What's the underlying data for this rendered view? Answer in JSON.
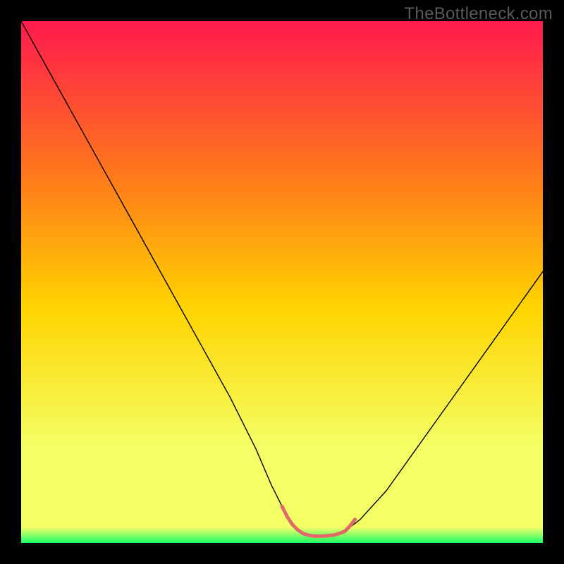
{
  "watermark": "TheBottleneck.com",
  "chart_data": {
    "type": "line",
    "title": "",
    "xlabel": "",
    "ylabel": "",
    "xlim": [
      0,
      100
    ],
    "ylim": [
      0,
      100
    ],
    "background_gradient": {
      "top": "#ff1a4d",
      "upper_mid": "#ff7a1a",
      "mid": "#ffd400",
      "lower_mid": "#f4ff66",
      "bottom": "#1aff66"
    },
    "series": [
      {
        "name": "bottleneck-curve",
        "color": "#000000",
        "width": 1.4,
        "x": [
          0,
          5,
          10,
          15,
          20,
          25,
          30,
          35,
          40,
          45,
          48,
          50,
          52,
          54,
          56,
          58,
          60,
          62,
          65,
          70,
          75,
          80,
          85,
          90,
          95,
          100
        ],
        "values": [
          100,
          91,
          82,
          73,
          64,
          55,
          46,
          37,
          28,
          18,
          11,
          7,
          3.5,
          1.8,
          1.3,
          1.3,
          1.5,
          2.2,
          4.5,
          10,
          17,
          24,
          31,
          38,
          45,
          52
        ]
      },
      {
        "name": "optimal-band",
        "color": "#e06a6a",
        "width": 5,
        "x": [
          50,
          51,
          52,
          53,
          54,
          55,
          56,
          57,
          58,
          59,
          60,
          61,
          62,
          63,
          64
        ],
        "values": [
          7,
          5,
          3.5,
          2.5,
          1.8,
          1.5,
          1.3,
          1.3,
          1.3,
          1.4,
          1.5,
          1.8,
          2.2,
          3.2,
          4.5
        ]
      }
    ]
  }
}
